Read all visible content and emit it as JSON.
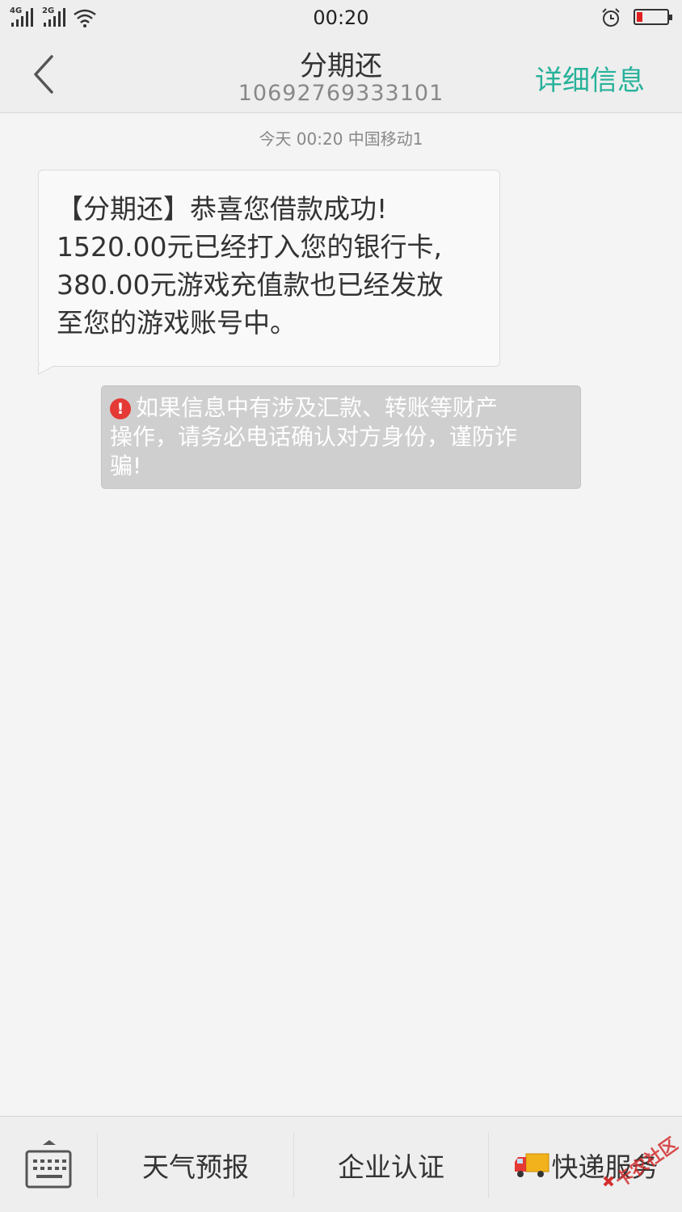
{
  "status_bar": {
    "network_1": "4G",
    "network_2": "2G",
    "time": "00:20",
    "icons": [
      "signal-icon",
      "wifi-icon",
      "alarm-icon",
      "battery-low-icon"
    ],
    "battery_level": 0.2,
    "battery_color": "#e02020"
  },
  "header": {
    "back_icon": "chevron-left-icon",
    "title": "分期还",
    "phone_number": "10692769333101",
    "detail_label": "详细信息",
    "accent_color": "#27b29a"
  },
  "conversation": {
    "timestamp": "今天  00:20  中国移动1",
    "messages": [
      {
        "lines": [
          "【分期还】恭喜您借款成功!",
          "1520.00元已经打入您的银行卡,",
          "380.00元游戏充值款也已经发放",
          "至您的游戏账号中。"
        ]
      }
    ],
    "warning": {
      "icon": "exclamation-icon",
      "lines": [
        "如果信息中有涉及汇款、转账等财产",
        "操作，请务必电话确认对方身份，谨防诈",
        "骗!"
      ]
    }
  },
  "bottom_menu": {
    "keyboard_icon": "keyboard-icon",
    "items": [
      {
        "label": "天气预报"
      },
      {
        "label": "企业认证"
      },
      {
        "label": "快递服务",
        "icon": "truck-icon"
      }
    ],
    "watermark": "卡农社区"
  }
}
